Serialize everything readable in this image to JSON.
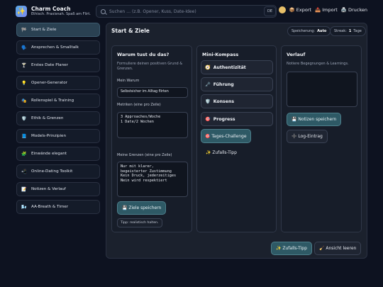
{
  "app": {
    "title": "Charm Coach",
    "subtitle": "Ethisch. Praxisnah. Spaß am Flirt."
  },
  "search": {
    "placeholder": "Suchen … (z.B. Opener, Kuss, Date-Idee)",
    "kbd": "DE"
  },
  "top_actions": {
    "export": "📦 Export",
    "import": "📥 Import",
    "print": "🖨️ Drucken"
  },
  "sidebar": {
    "items": [
      {
        "icon": "🏁",
        "label": "Start & Ziele",
        "active": true
      },
      {
        "icon": "🗣️",
        "label": "Ansprechen & Smalltalk"
      },
      {
        "icon": "🍸",
        "label": "Erstes Date Planer"
      },
      {
        "icon": "💡",
        "label": "Opener-Generator"
      },
      {
        "icon": "🎭",
        "label": "Rollenspiel & Training"
      },
      {
        "icon": "🛡️",
        "label": "Ethik & Grenzen"
      },
      {
        "icon": "📘",
        "label": "Models-Prinzipien"
      },
      {
        "icon": "🧩",
        "label": "Einwände elegant"
      },
      {
        "icon": "📲",
        "label": "Online-Dating Toolkit"
      },
      {
        "icon": "📝",
        "label": "Notizen & Verlauf"
      },
      {
        "icon": "🌬️",
        "label": "AA-Breath & Timer"
      }
    ]
  },
  "main": {
    "title": "Start & Ziele",
    "storage_label": "Speicherung:",
    "storage_value": "Auto",
    "streak_label": "Streak:",
    "streak_value": "1",
    "streak_unit": "Tage"
  },
  "why": {
    "title": "Warum tust du das?",
    "description": "Formuliere deinen positiven Grund & Grenzen.",
    "warum_label": "Mein Warum",
    "warum_value": "Selbstsicher im Alltag flirten",
    "metrics_label": "Metriken (eine pro Zeile)",
    "metrics_value": "3 Approaches/Woche\n1 Date/2 Wochen",
    "limits_label": "Meine Grenzen (eine pro Zeile)",
    "limits_value": "Nur mit klarer,\nbegeisterter Zustimmung\nKein Druck, jederzeitiges\nNein wird respektiert",
    "save_button": "💾 Ziele speichern",
    "tip": "Tipp: realistisch halten."
  },
  "compass": {
    "title": "Mini-Kompass",
    "items": [
      {
        "icon": "🧭",
        "label": "Authentizität"
      },
      {
        "icon": "🗝️",
        "label": "Führung"
      },
      {
        "icon": "🛡️",
        "label": "Konsens"
      },
      {
        "icon": "🎯",
        "label": "Progress"
      }
    ],
    "challenge_button": "🎯 Tages-Challenge",
    "random_button": "✨ Zufalls-Tipp"
  },
  "history": {
    "title": "Verlauf",
    "description": "Notiere Begegnungen & Learnings.",
    "notes_value": "",
    "save_button": "💾 Notizen speichern",
    "log_button": "➕ Log-Eintrag"
  },
  "footer": {
    "random_button": "✨ Zufalls-Tipp",
    "clear_button": "🧹 Ansicht leeren"
  }
}
